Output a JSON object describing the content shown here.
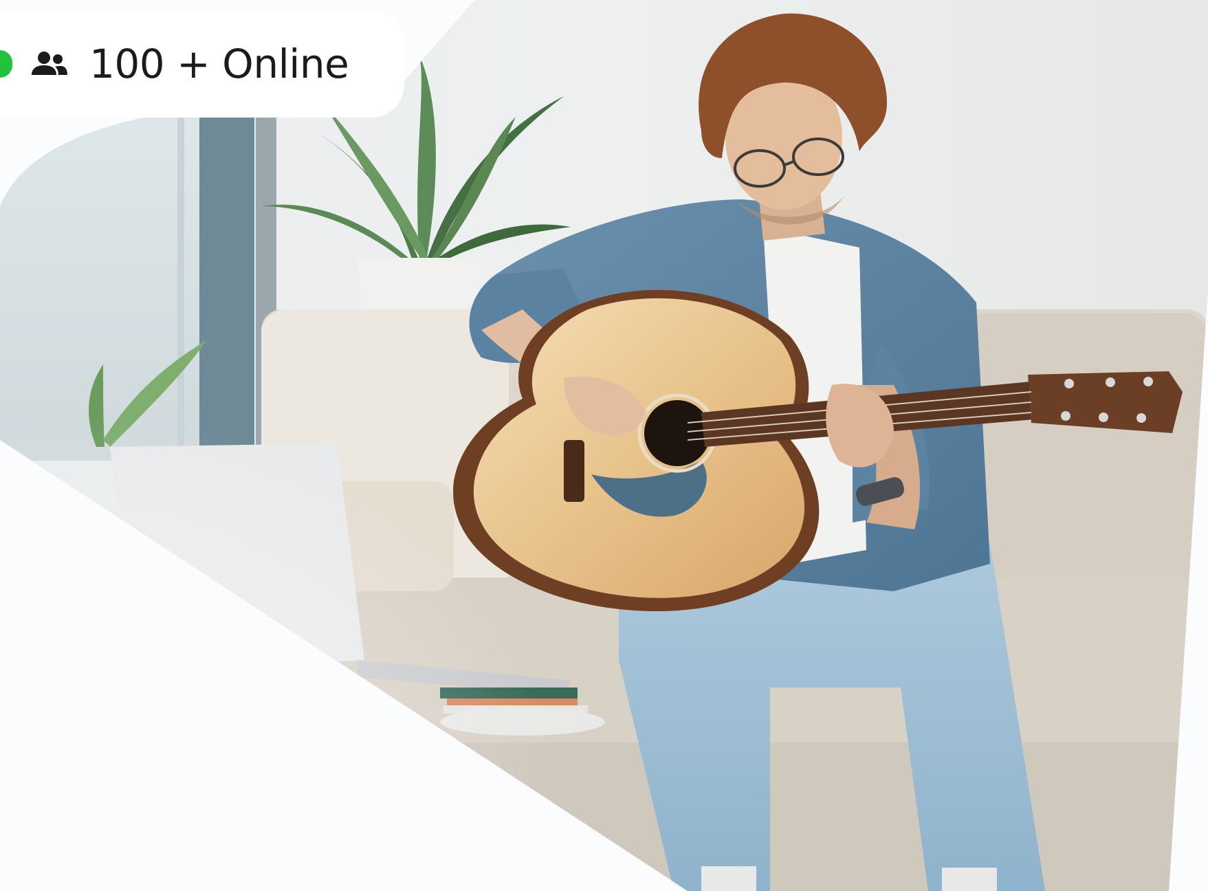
{
  "status": {
    "online_label": "100 + Online",
    "indicator_color": "#22c33a",
    "icon": "users-icon"
  },
  "hero": {
    "photo": "man-playing-acoustic-guitar-on-sofa"
  },
  "colors": {
    "background": "#fbfcfe",
    "pill": "#ffffff",
    "text": "#1b1b1b"
  }
}
